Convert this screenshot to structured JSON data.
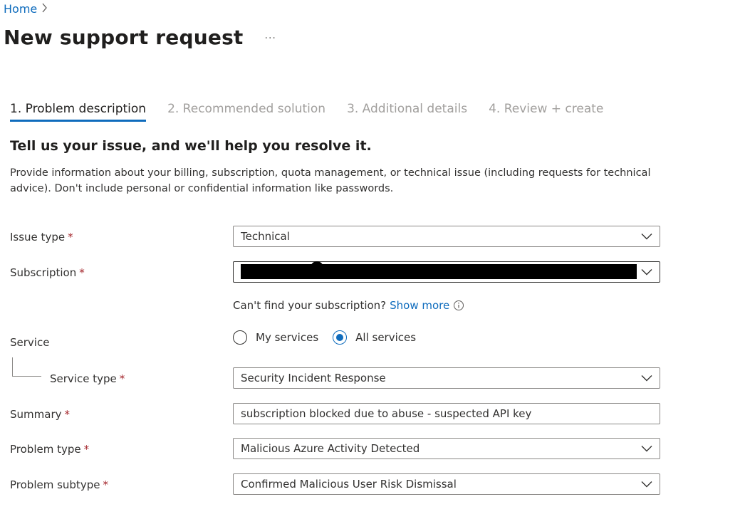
{
  "breadcrumb": {
    "home": "Home"
  },
  "page": {
    "title": "New support request",
    "more": "···"
  },
  "tabs": [
    {
      "label": "1. Problem description",
      "active": true
    },
    {
      "label": "2. Recommended solution",
      "active": false
    },
    {
      "label": "3. Additional details",
      "active": false
    },
    {
      "label": "4. Review + create",
      "active": false
    }
  ],
  "intro": {
    "heading": "Tell us your issue, and we'll help you resolve it.",
    "description": "Provide information about your billing, subscription, quota management, or technical issue (including requests for technical advice). Don't include personal or confidential information like passwords."
  },
  "form": {
    "required_marker": "*",
    "issue_type": {
      "label": "Issue type",
      "value": "Technical"
    },
    "subscription": {
      "label": "Subscription",
      "value": "",
      "hint": "Can't find your subscription?",
      "hint_link": "Show more"
    },
    "service": {
      "label": "Service",
      "options": [
        "My services",
        "All services"
      ],
      "selected": "All services"
    },
    "service_type": {
      "label": "Service type",
      "value": "Security Incident Response"
    },
    "summary": {
      "label": "Summary",
      "value": "subscription blocked due to abuse - suspected API key"
    },
    "problem_type": {
      "label": "Problem type",
      "value": "Malicious Azure Activity Detected"
    },
    "problem_subtype": {
      "label": "Problem subtype",
      "value": "Confirmed Malicious User Risk Dismissal"
    }
  },
  "colors": {
    "accent": "#0f6cbd",
    "required": "#a4262c",
    "inactive_tab": "#a19f9d"
  }
}
